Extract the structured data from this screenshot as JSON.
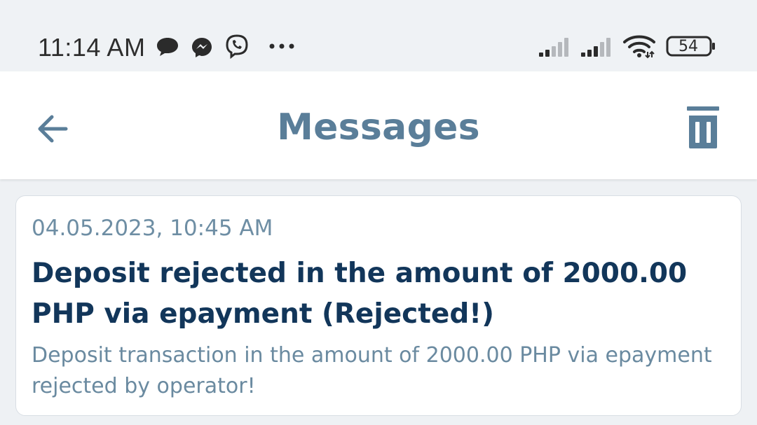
{
  "status_bar": {
    "time": "11:14 AM",
    "notification_icons": [
      "chat-bubble-icon",
      "messenger-icon",
      "viber-icon",
      "more-dots-icon"
    ],
    "system_icons": [
      "signal-icon",
      "signal-icon",
      "wifi-icon",
      "battery-icon"
    ],
    "battery_level": "54"
  },
  "app_bar": {
    "title": "Messages",
    "back_icon": "arrow-left-icon",
    "action_icon": "trash-icon"
  },
  "messages": [
    {
      "date": "04.05.2023, 10:45 AM",
      "title": "Deposit rejected in the amount of 2000.00 PHP via epayment (Rejected!)",
      "body": "Deposit transaction in the amount of 2000.00 PHP via epayment rejected by operator!"
    }
  ],
  "colors": {
    "accent": "#5a7e99",
    "title_text": "#12365a",
    "secondary_text": "#6e8ea4",
    "background": "#eef1f4"
  }
}
